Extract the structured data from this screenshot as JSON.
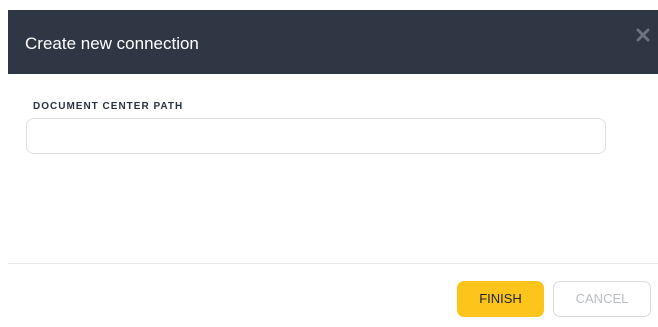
{
  "dialog": {
    "title": "Create new connection",
    "close_icon": "close-icon"
  },
  "form": {
    "document_center_path": {
      "label": "DOCUMENT CENTER PATH",
      "value": "",
      "placeholder": ""
    }
  },
  "footer": {
    "finish_label": "FINISH",
    "cancel_label": "CANCEL"
  },
  "colors": {
    "header_bg": "#2f3745",
    "primary_button": "#fdc51b",
    "cancel_text": "#b9bdc3"
  }
}
